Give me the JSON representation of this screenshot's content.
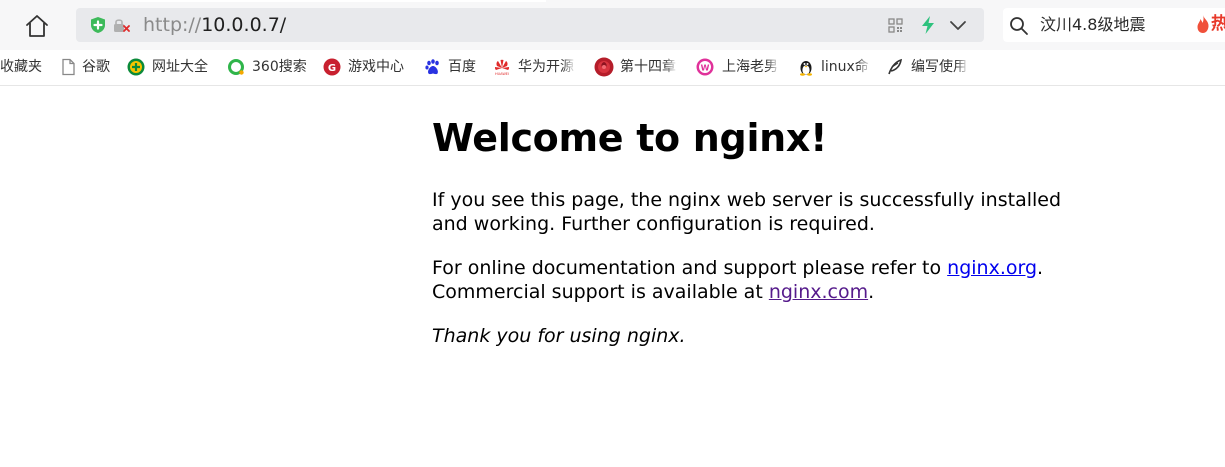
{
  "toolbar": {
    "url_scheme": "http://",
    "url_host": "10.0.0.7/",
    "search_query": "汶川4.8级地震",
    "hot_label": "热"
  },
  "bookmarks": [
    {
      "label": "收藏夹",
      "icon": "none"
    },
    {
      "label": "谷歌",
      "icon": "page-icon"
    },
    {
      "label": "网址大全",
      "icon": "hao360-icon"
    },
    {
      "label": "360搜索",
      "icon": "so360-icon"
    },
    {
      "label": "游戏中心",
      "icon": "game-center-icon"
    },
    {
      "label": "百度",
      "icon": "baidu-paw-icon"
    },
    {
      "label": "华为开源",
      "icon": "huawei-icon"
    },
    {
      "label": "第十四章",
      "icon": "rose-icon"
    },
    {
      "label": "上海老男",
      "icon": "wamp-icon"
    },
    {
      "label": "linux命",
      "icon": "tux-icon"
    },
    {
      "label": "编写使用",
      "icon": "quill-icon"
    }
  ],
  "page": {
    "heading": "Welcome to nginx!",
    "p1": "If you see this page, the nginx web server is successfully installed and working. Further configuration is required.",
    "p2_prefix": "For online documentation and support please refer to ",
    "p2_link": "nginx.org",
    "p2_mid": ".",
    "p2_line2_prefix": "Commercial support is available at ",
    "p2_link2": "nginx.com",
    "p2_suffix": ".",
    "p3": "Thank you for using nginx."
  },
  "colors": {
    "link": "#0000ee",
    "visited_link": "#551a8b",
    "security_green": "#3dba5a",
    "bolt_green": "#2ec27e",
    "hot_red": "#e8392a"
  }
}
